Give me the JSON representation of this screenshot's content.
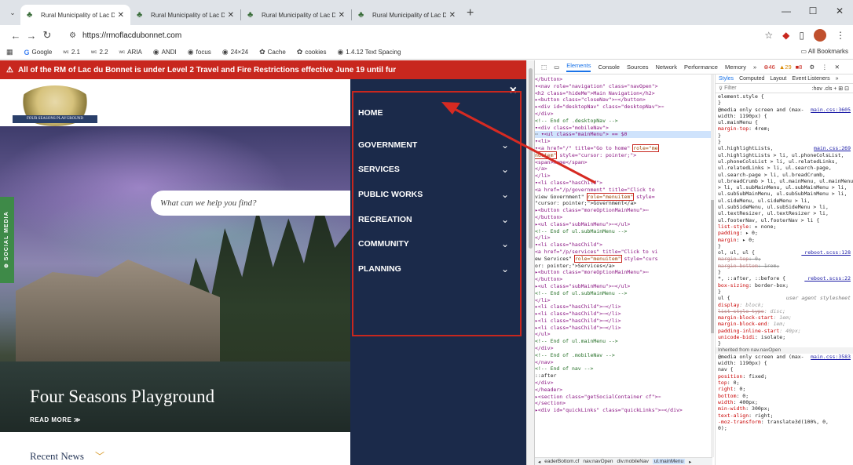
{
  "browser": {
    "tabs": [
      {
        "label": "Rural Municipality of Lac Du Bo",
        "active": true
      },
      {
        "label": "Rural Municipality of Lac Du Bo",
        "active": false
      },
      {
        "label": "Rural Municipality of Lac Du Bo",
        "active": false
      },
      {
        "label": "Rural Municipality of Lac Du Bo",
        "active": false
      }
    ],
    "new_tab": "+",
    "url": "https://rmoflacdubonnet.com",
    "bookmarks": [
      "Google",
      "2.1",
      "2.2",
      "ARIA",
      "ANDI",
      "focus",
      "24×24",
      "Cache",
      "cookies",
      "1.4.12 Text Spacing"
    ],
    "all_bookmarks": "All Bookmarks"
  },
  "site": {
    "alert": "All of the RM of Lac du Bonnet is under Level 2 Travel and Fire Restrictions effective June 19 until fur",
    "logo_ribbon": "FOUR SEASONS PLAYGROUND",
    "search_placeholder": "What can we help you find?",
    "social_tab": "⊕ SOCIAL MEDIA",
    "hero_title": "Four Seasons Playground",
    "read_more": "READ MORE ≫",
    "recent_news": "Recent News",
    "nav_close": "×",
    "nav_items": [
      {
        "label": "HOME",
        "has_chevron": false
      },
      {
        "label": "GOVERNMENT",
        "has_chevron": true
      },
      {
        "label": "SERVICES",
        "has_chevron": true
      },
      {
        "label": "PUBLIC WORKS",
        "has_chevron": true
      },
      {
        "label": "RECREATION",
        "has_chevron": true
      },
      {
        "label": "COMMUNITY",
        "has_chevron": true
      },
      {
        "label": "PLANNING",
        "has_chevron": true
      }
    ],
    "colors": {
      "alert_bg": "#c8271e",
      "nav_bg": "#1b2a4a",
      "social_bg": "#3e8a48",
      "highlight": "#c8271e"
    }
  },
  "devtools": {
    "tabs": [
      "Elements",
      "Console",
      "Sources",
      "Network",
      "Performance",
      "Memory",
      "»"
    ],
    "errors": "46",
    "warnings": "29",
    "info": "8",
    "styles_tabs": [
      "Styles",
      "Computed",
      "Layout",
      "Event Listeners",
      "»"
    ],
    "filter_placeholder": "Filter",
    "filter_right": ":hov .cls + ⊞ ⊡",
    "breadcrumbs": [
      "eaderBottom.cf",
      "nav.navOpen",
      "div.mobileNav",
      "ul.mainMenu"
    ],
    "dom_lines": [
      "        </button>",
      "      ▾<nav role=\"navigation\" class=\"navOpen\">",
      "         <h2 class=\"hideMe\">Main Navigation</h2>",
      "        ▸<button class=\"closeNav\">⋯</button>",
      "        ▸<div id=\"desktopNav\" class=\"desktopNav\">⋯",
      "         </div>",
      "         <!-- End of .desktopNav -->",
      "        ▾<div class=\"mobileNav\">",
      "          ▾<ul class=\"mainMenu\"> == $0",
      "            ▾<li>",
      "              ▾<a href=\"/\" title=\"Go to home\" role=\"me",
      "               nuitem\" style=\"cursor: pointer;\">",
      "                  <span>Home</span>",
      "                </a>",
      "              </li>",
      "            ▾<li class=\"hasChild\">",
      "                <a href=\"/p/government\" title=\"Click to",
      "                view Government\" role=\"menuitem\" style=",
      "                \"cursor: pointer;\">Government</a>",
      "              ▸<button class=\"moreOptionMainMenu\">⋯",
      "                </button>",
      "              ▸<ul class=\"subMainMenu\">⋯</ul>",
      "                <!-- End of ul.subMainMenu -->",
      "              </li>",
      "            ▾<li class=\"hasChild\">",
      "                <a href=\"/p/services\" title=\"Click to vi",
      "                ew Services\" role=\"menuitem\" style=\"curs",
      "                or: pointer;\">Services</a>",
      "              ▸<button class=\"moreOptionMainMenu\">⋯",
      "                </button>",
      "              ▸<ul class=\"subMainMenu\">⋯</ul>",
      "                <!-- End of ul.subMainMenu -->",
      "              </li>",
      "            ▸<li class=\"hasChild\">⋯</li>",
      "            ▸<li class=\"hasChild\">⋯</li>",
      "            ▸<li class=\"hasChild\">⋯</li>",
      "            ▸<li class=\"hasChild\">⋯</li>",
      "            </ul>",
      "            <!-- End of ul.mainMenu -->",
      "          </div>",
      "          <!-- End of .mobileNav -->",
      "        </nav>",
      "        <!-- End of nav -->",
      "        ::after",
      "      </div>",
      "    </header>",
      "  ▸<section class=\"getSocialContainer cf\">⋯",
      "    </section>",
      "  ▸<div id=\"quickLinks\" class=\"quickLinks\">⋯</div>"
    ],
    "style_lines": [
      "element.style {",
      "}",
      "@media only screen and (max-",
      "width: 1190px) {",
      "  ul.mainMenu {",
      "    margin-top: 4rem;",
      "  }",
      "}",
      "ul.highlightLists,",
      "ul.highlightLists > li, ul.phoneColsList,",
      "ul.phoneColsList > li, ul.relatedLinks,",
      "ul.relatedLinks > li, ul.search-page,",
      "ul.search-page > li, ul.breadCrumb,",
      "ul.breadCrumb > li, ul.mainMenu, ul.mainMenu",
      "> li, ul.subMainMenu, ul.subMainMenu > li,",
      "ul.subSubMainMenu, ul.subSubMainMenu > li,",
      "ul.sideMenu, ul.sideMenu > li,",
      "ul.subSideMenu, ul.subSideMenu > li,",
      "ul.textResizer, ul.textResizer > li,",
      "ul.footerNav, ul.footerNav > li {",
      "  list-style: ▸ none;",
      "  padding: ▸ 0;",
      "  margin: ▸ 0;",
      "}",
      "ol, ul, ul {",
      "  margin-top: 0;",
      "  margin-bottom: 1rem;",
      "}",
      "*, ::after, ::before {",
      "  box-sizing: border-box;",
      "}",
      "ul {",
      "  display: block;",
      "  list-style-type: disc;",
      "  margin-block-start: 1em;",
      "  margin-block-end: 1em;",
      "  padding-inline-start: 40px;",
      "  unicode-bidi: isolate;",
      "}",
      "Inherited from nav.navOpen",
      "@media only screen and (max-",
      "width: 1190px) {",
      "  nav {",
      "    position: fixed;",
      "    top: 0;",
      "    right: 0;",
      "    bottom: 0;",
      "    width: 400px;",
      "    min-width: 300px;",
      "    text-align: right;",
      "    -moz-transform: translate3d(100%, 0,",
      "    0);"
    ],
    "style_sources": {
      "0": "",
      "2": "main.css:3605",
      "8": "main.css:269",
      "24": "_reboot.scss:128",
      "28": "_reboot.scss:22",
      "31": "user agent stylesheet",
      "40": "main.css:3583"
    }
  }
}
